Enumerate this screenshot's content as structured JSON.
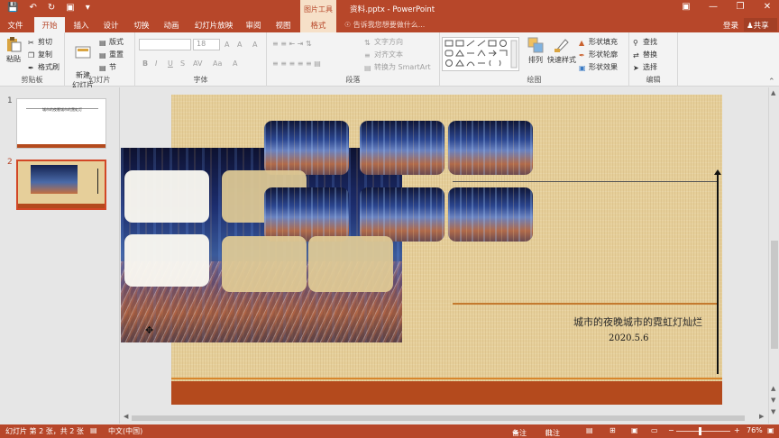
{
  "window": {
    "doc_title": "资料.pptx - PowerPoint",
    "context_tab_label": "图片工具",
    "quick_access": [
      "save-icon",
      "undo-icon",
      "redo-icon",
      "start-slideshow-icon",
      "customize-icon"
    ],
    "controls": [
      "ribbon-display-icon",
      "minimize-icon",
      "restore-icon",
      "close-icon"
    ]
  },
  "tabs": {
    "file": "文件",
    "items": [
      "开始",
      "插入",
      "设计",
      "切换",
      "动画",
      "幻灯片放映",
      "审阅",
      "视图",
      "格式"
    ],
    "active_index": 0,
    "tell_me": "告诉我您想要做什么...",
    "sign_in": "登录",
    "share": "共享"
  },
  "ribbon": {
    "clipboard": {
      "label": "剪贴板",
      "paste": "粘贴",
      "cut": "剪切",
      "copy": "复制",
      "format_painter": "格式刷"
    },
    "slides": {
      "label": "幻灯片",
      "new_slide": "新建\n幻灯片",
      "layout": "版式",
      "reset": "重置",
      "section": "节"
    },
    "font": {
      "label": "字体",
      "font_name": "",
      "font_size": "18",
      "bold": "B",
      "italic": "I",
      "underline": "U",
      "strike": "S",
      "spacing": "AV",
      "case": "Aa",
      "grow": "A",
      "shrink": "A",
      "clear": "A",
      "color": "A"
    },
    "paragraph": {
      "label": "段落",
      "text_direction": "文字方向",
      "align_text": "对齐文本",
      "smartart": "转换为 SmartArt"
    },
    "drawing": {
      "label": "绘图",
      "arrange": "排列",
      "quick_styles": "快速样式",
      "shape_fill": "形状填充",
      "shape_outline": "形状轮廓",
      "shape_effects": "形状效果"
    },
    "editing": {
      "label": "编辑",
      "find": "查找",
      "replace": "替换",
      "select": "选择"
    }
  },
  "thumbnails": [
    {
      "number": "1",
      "title": "城市的夜晚城市的霓虹灯",
      "active": false
    },
    {
      "number": "2",
      "active": true
    }
  ],
  "slide": {
    "subtitle": "城市的夜晚城市的霓虹灯灿烂",
    "date": "2020.5.6"
  },
  "status": {
    "slide_info": "幻灯片 第 2 张，共 2 张",
    "language": "中文(中国)",
    "notes": "备注",
    "comments": "批注",
    "zoom": "76%"
  },
  "colors": {
    "accent": "#b7472a",
    "slide_background": "#e6cf9a",
    "footer_band": "#b44a1d"
  }
}
